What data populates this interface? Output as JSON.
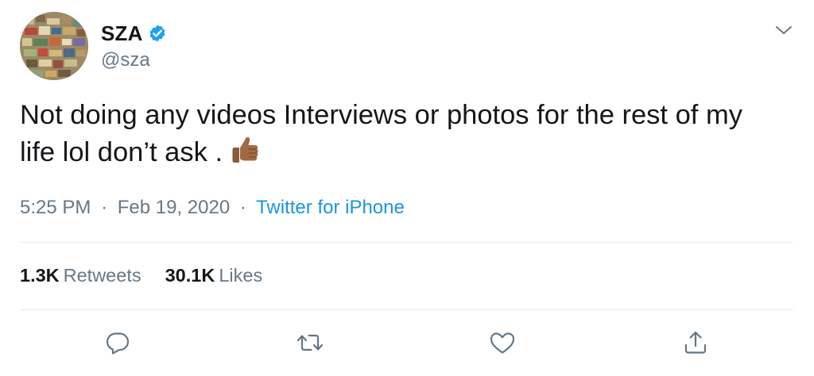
{
  "user": {
    "display_name": "SZA",
    "handle": "@sza",
    "verified": true,
    "verified_color": "#1da1f2"
  },
  "tweet": {
    "text": "Not doing any videos Interviews or photos for the rest of my life lol don’t ask .",
    "emoji": "thumbs-up-medium-dark-skin-tone"
  },
  "meta": {
    "time": "5:25 PM",
    "date": "Feb 19, 2020",
    "separator": "·",
    "source": "Twitter for iPhone"
  },
  "stats": {
    "retweets_count": "1.3K",
    "retweets_label": "Retweets",
    "likes_count": "30.1K",
    "likes_label": "Likes"
  },
  "actions": [
    "reply-icon",
    "retweet-icon",
    "like-icon",
    "share-icon"
  ],
  "colors": {
    "text": "#14171a",
    "secondary": "#657786",
    "link": "#1b95e0",
    "divider": "#e6ecf0"
  }
}
